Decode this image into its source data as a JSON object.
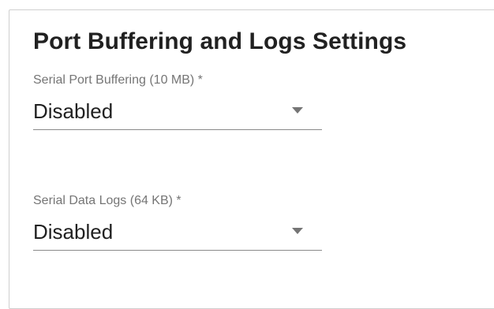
{
  "section": {
    "title": "Port Buffering and Logs Settings"
  },
  "fields": [
    {
      "label": "Serial Port Buffering (10 MB) *",
      "value": "Disabled",
      "icon": "arrow-drop-down-icon"
    },
    {
      "label": "Serial Data Logs (64 KB) *",
      "value": "Disabled",
      "icon": "arrow-drop-down-icon"
    }
  ],
  "colors": {
    "title": "#212121",
    "label": "#757575",
    "value": "#212121",
    "underline": "#8a8a8a",
    "card_border": "#cfcfcf"
  }
}
